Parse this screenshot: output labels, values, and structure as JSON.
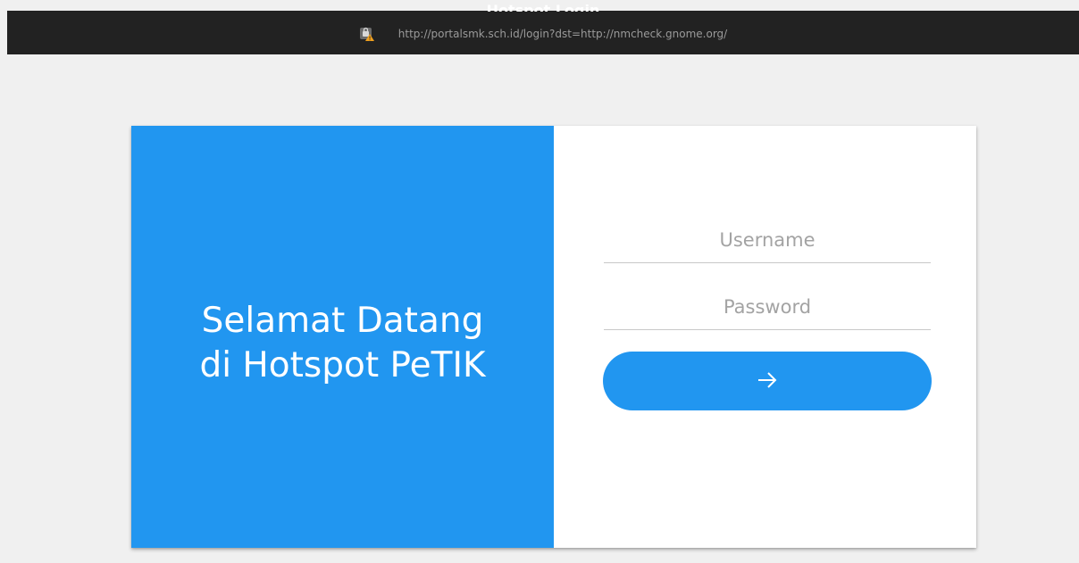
{
  "window": {
    "title": "Hotspot Login",
    "url": "http://portalsmk.sch.id/login?dst=http://nmcheck.gnome.org/",
    "security_icon": "insecure-lock-icon"
  },
  "welcome": {
    "line1": "Selamat Datang",
    "line2": "di Hotspot PeTIK"
  },
  "login_form": {
    "username_placeholder": "Username",
    "password_placeholder": "Password",
    "submit_icon": "arrow-right-icon"
  },
  "colors": {
    "accent": "#2196f0",
    "topbar": "#222222",
    "background": "#f0f0f0"
  }
}
